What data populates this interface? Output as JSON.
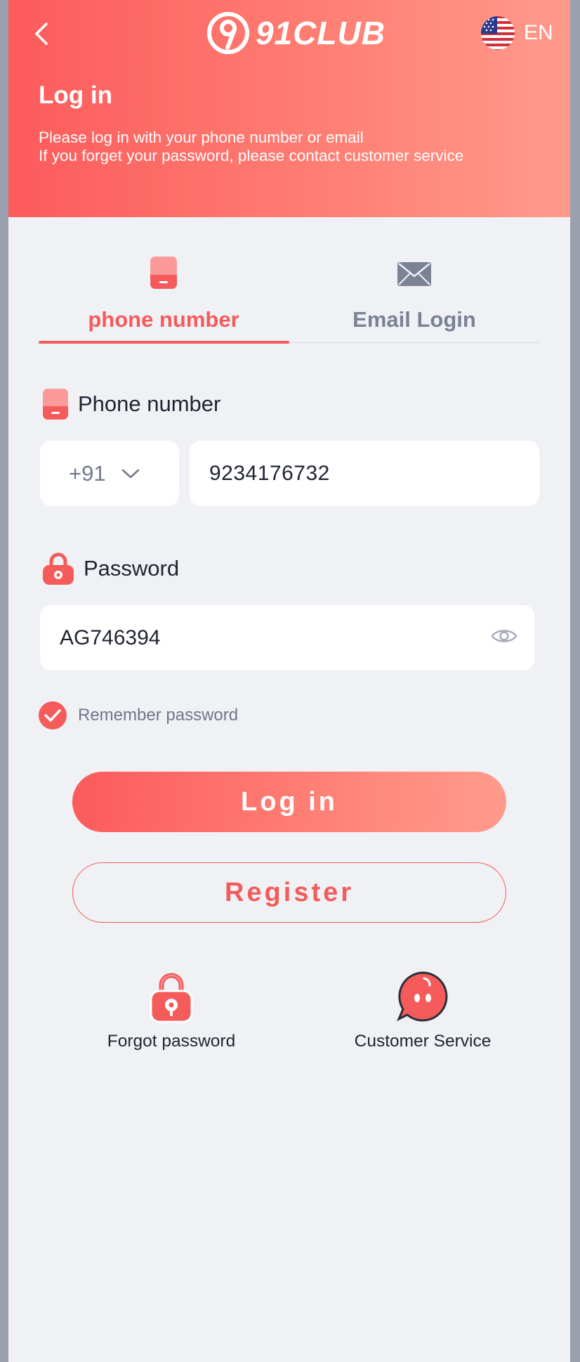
{
  "header": {
    "brand": "91CLUB",
    "language": "EN",
    "title": "Log in",
    "description_line1": "Please log in with your phone number or email",
    "description_line2": "If you forget your password, please contact customer service"
  },
  "tabs": [
    {
      "label": "phone number",
      "icon": "phone-icon",
      "active": true
    },
    {
      "label": "Email Login",
      "icon": "envelope-icon",
      "active": false
    }
  ],
  "phone_field": {
    "label": "Phone number",
    "country_code": "+91",
    "value": "9234176732"
  },
  "password_field": {
    "label": "Password",
    "value": "AG746394"
  },
  "remember": {
    "label": "Remember password",
    "checked": true
  },
  "buttons": {
    "login": "Log in",
    "register": "Register"
  },
  "quick_links": [
    {
      "label": "Forgot password",
      "icon": "lock-icon"
    },
    {
      "label": "Customer Service",
      "icon": "chat-icon"
    }
  ],
  "colors": {
    "accent": "#f55b5b",
    "gradient_start": "#fc5b5b",
    "gradient_end": "#ff9b8c",
    "background": "#f0f1f5"
  }
}
